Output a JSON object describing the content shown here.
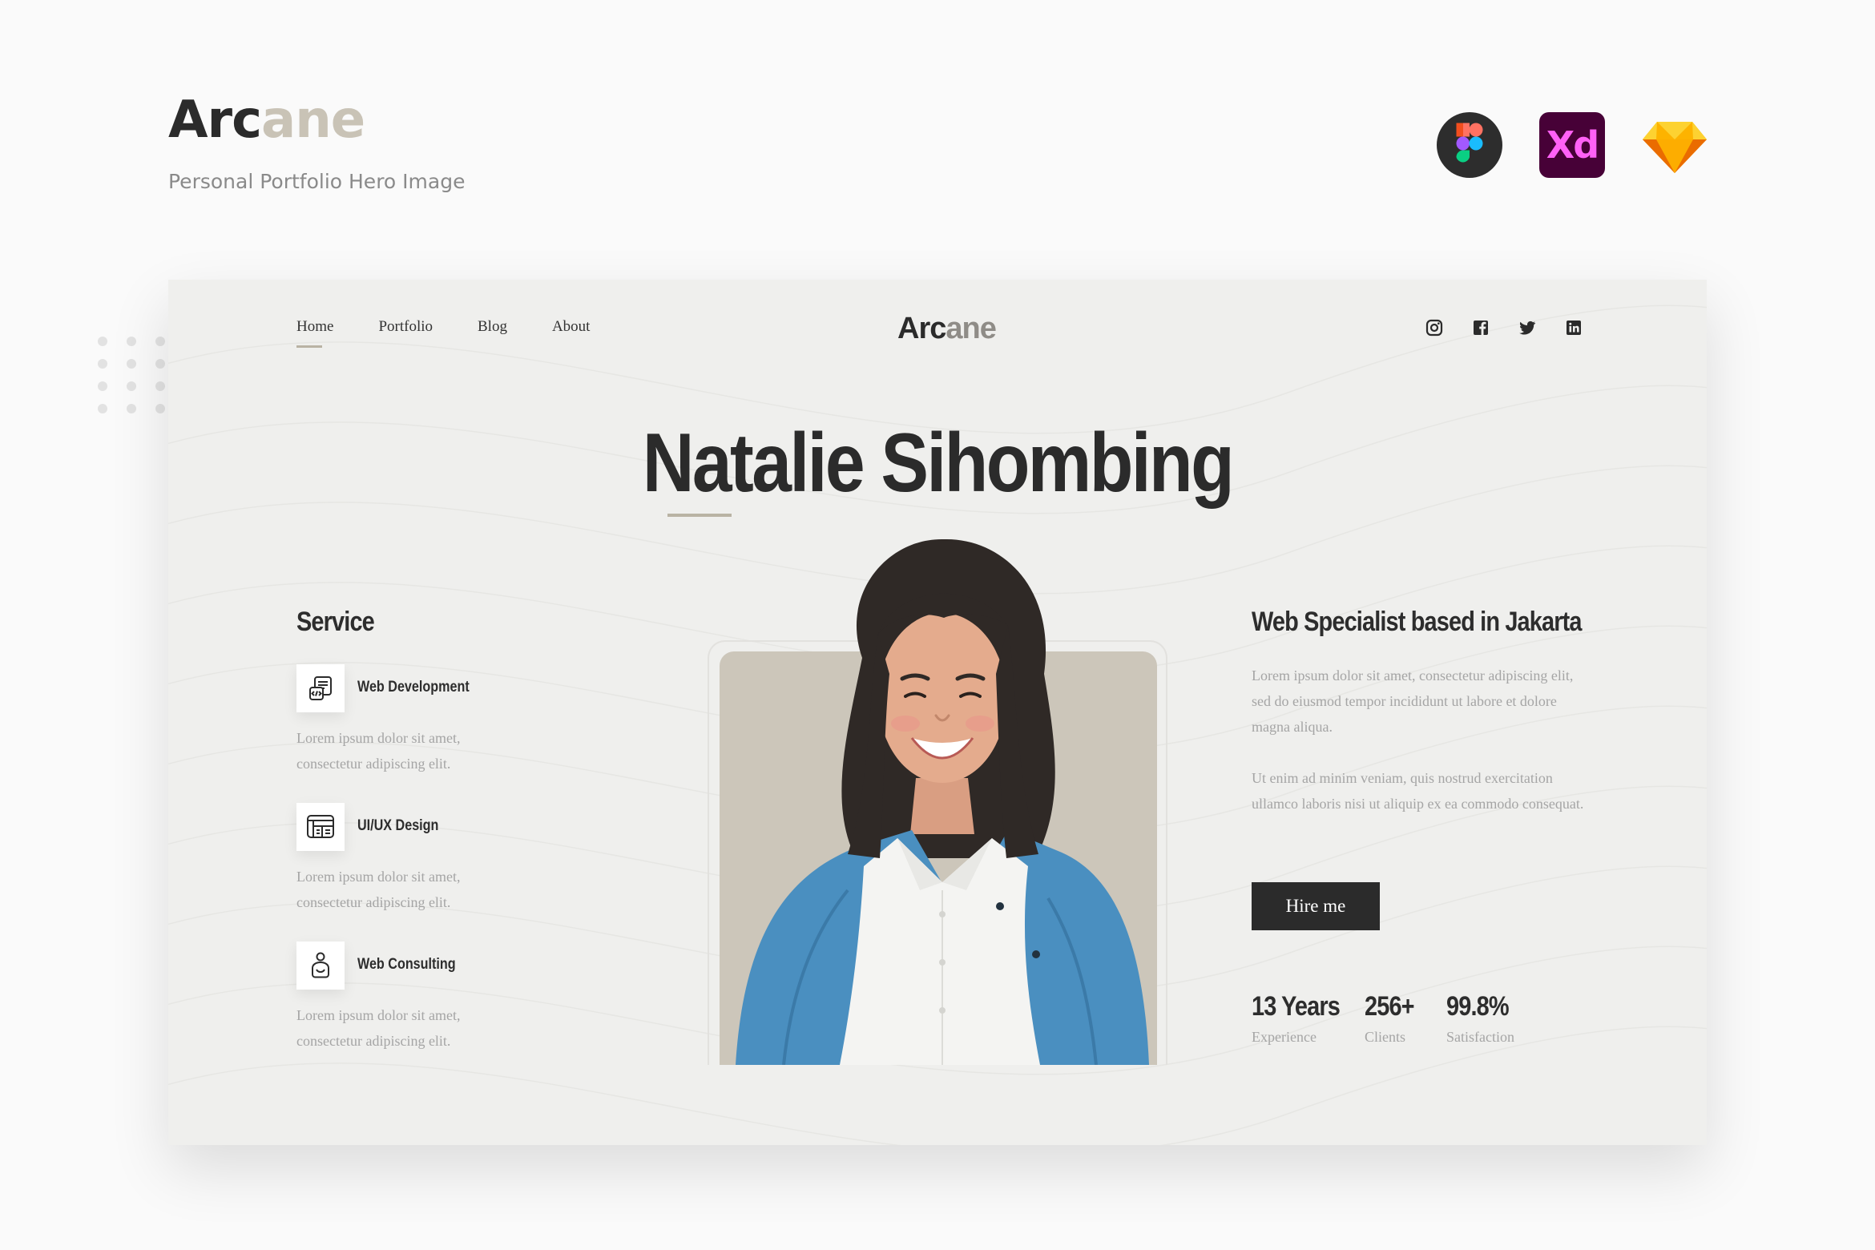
{
  "brand": {
    "name_part1": "Arc",
    "name_part2": "ane",
    "subtitle": "Personal Portfolio Hero Image"
  },
  "tools": [
    {
      "name": "figma-icon"
    },
    {
      "name": "adobe-xd-icon",
      "label": "Xd"
    },
    {
      "name": "sketch-icon"
    }
  ],
  "nav": {
    "items": [
      "Home",
      "Portfolio",
      "Blog",
      "About"
    ],
    "active": "Home"
  },
  "logo": {
    "part1": "Arc",
    "part2": "ane"
  },
  "socials": [
    "instagram-icon",
    "facebook-icon",
    "twitter-icon",
    "linkedin-icon"
  ],
  "hero": {
    "name": "Natalie Sihombing"
  },
  "services": {
    "title": "Service",
    "items": [
      {
        "icon": "web-development-icon",
        "label": "Web Development",
        "description": "Lorem ipsum dolor sit amet, consectetur adipiscing elit."
      },
      {
        "icon": "ui-ux-design-icon",
        "label": "UI/UX Design",
        "description": "Lorem ipsum dolor sit amet, consectetur adipiscing elit."
      },
      {
        "icon": "web-consulting-icon",
        "label": "Web Consulting",
        "description": "Lorem ipsum dolor sit amet, consectetur adipiscing elit."
      }
    ]
  },
  "about": {
    "title": "Web Specialist based in Jakarta",
    "paragraph1": "Lorem ipsum dolor sit amet, consectetur adipiscing elit, sed do eiusmod tempor incididunt ut labore et dolore magna aliqua.",
    "paragraph2": "Ut enim ad minim veniam, quis nostrud exercitation ullamco laboris nisi ut aliquip ex ea commodo consequat.",
    "cta": "Hire me"
  },
  "stats": [
    {
      "value": "13 Years",
      "label": "Experience"
    },
    {
      "value": "256+",
      "label": "Clients"
    },
    {
      "value": "99.8%",
      "label": "Satisfaction"
    }
  ],
  "colors": {
    "accent": "#b9b3a4",
    "dark": "#2b2b2b",
    "card": "#efefed",
    "photo_bg": "#ccc6ba",
    "cardigan": "#4a8fc0"
  }
}
